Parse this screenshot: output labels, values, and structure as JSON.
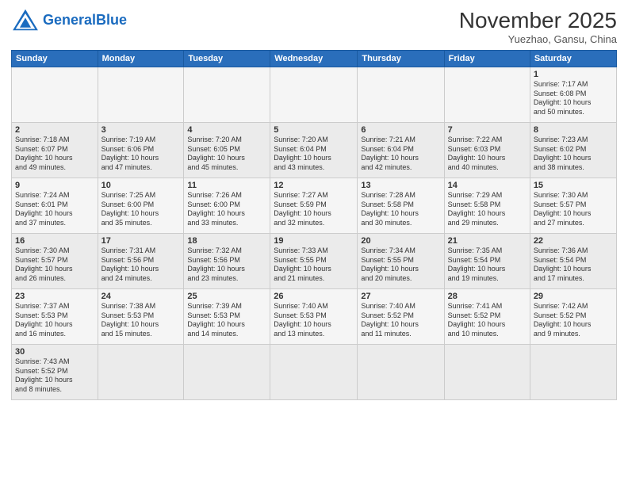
{
  "header": {
    "logo_general": "General",
    "logo_blue": "Blue",
    "month_title": "November 2025",
    "location": "Yuezhao, Gansu, China"
  },
  "weekdays": [
    "Sunday",
    "Monday",
    "Tuesday",
    "Wednesday",
    "Thursday",
    "Friday",
    "Saturday"
  ],
  "weeks": [
    [
      {
        "day": "",
        "info": ""
      },
      {
        "day": "",
        "info": ""
      },
      {
        "day": "",
        "info": ""
      },
      {
        "day": "",
        "info": ""
      },
      {
        "day": "",
        "info": ""
      },
      {
        "day": "",
        "info": ""
      },
      {
        "day": "1",
        "info": "Sunrise: 7:17 AM\nSunset: 6:08 PM\nDaylight: 10 hours\nand 50 minutes."
      }
    ],
    [
      {
        "day": "2",
        "info": "Sunrise: 7:18 AM\nSunset: 6:07 PM\nDaylight: 10 hours\nand 49 minutes."
      },
      {
        "day": "3",
        "info": "Sunrise: 7:19 AM\nSunset: 6:06 PM\nDaylight: 10 hours\nand 47 minutes."
      },
      {
        "day": "4",
        "info": "Sunrise: 7:20 AM\nSunset: 6:05 PM\nDaylight: 10 hours\nand 45 minutes."
      },
      {
        "day": "5",
        "info": "Sunrise: 7:20 AM\nSunset: 6:04 PM\nDaylight: 10 hours\nand 43 minutes."
      },
      {
        "day": "6",
        "info": "Sunrise: 7:21 AM\nSunset: 6:04 PM\nDaylight: 10 hours\nand 42 minutes."
      },
      {
        "day": "7",
        "info": "Sunrise: 7:22 AM\nSunset: 6:03 PM\nDaylight: 10 hours\nand 40 minutes."
      },
      {
        "day": "8",
        "info": "Sunrise: 7:23 AM\nSunset: 6:02 PM\nDaylight: 10 hours\nand 38 minutes."
      }
    ],
    [
      {
        "day": "9",
        "info": "Sunrise: 7:24 AM\nSunset: 6:01 PM\nDaylight: 10 hours\nand 37 minutes."
      },
      {
        "day": "10",
        "info": "Sunrise: 7:25 AM\nSunset: 6:00 PM\nDaylight: 10 hours\nand 35 minutes."
      },
      {
        "day": "11",
        "info": "Sunrise: 7:26 AM\nSunset: 6:00 PM\nDaylight: 10 hours\nand 33 minutes."
      },
      {
        "day": "12",
        "info": "Sunrise: 7:27 AM\nSunset: 5:59 PM\nDaylight: 10 hours\nand 32 minutes."
      },
      {
        "day": "13",
        "info": "Sunrise: 7:28 AM\nSunset: 5:58 PM\nDaylight: 10 hours\nand 30 minutes."
      },
      {
        "day": "14",
        "info": "Sunrise: 7:29 AM\nSunset: 5:58 PM\nDaylight: 10 hours\nand 29 minutes."
      },
      {
        "day": "15",
        "info": "Sunrise: 7:30 AM\nSunset: 5:57 PM\nDaylight: 10 hours\nand 27 minutes."
      }
    ],
    [
      {
        "day": "16",
        "info": "Sunrise: 7:30 AM\nSunset: 5:57 PM\nDaylight: 10 hours\nand 26 minutes."
      },
      {
        "day": "17",
        "info": "Sunrise: 7:31 AM\nSunset: 5:56 PM\nDaylight: 10 hours\nand 24 minutes."
      },
      {
        "day": "18",
        "info": "Sunrise: 7:32 AM\nSunset: 5:56 PM\nDaylight: 10 hours\nand 23 minutes."
      },
      {
        "day": "19",
        "info": "Sunrise: 7:33 AM\nSunset: 5:55 PM\nDaylight: 10 hours\nand 21 minutes."
      },
      {
        "day": "20",
        "info": "Sunrise: 7:34 AM\nSunset: 5:55 PM\nDaylight: 10 hours\nand 20 minutes."
      },
      {
        "day": "21",
        "info": "Sunrise: 7:35 AM\nSunset: 5:54 PM\nDaylight: 10 hours\nand 19 minutes."
      },
      {
        "day": "22",
        "info": "Sunrise: 7:36 AM\nSunset: 5:54 PM\nDaylight: 10 hours\nand 17 minutes."
      }
    ],
    [
      {
        "day": "23",
        "info": "Sunrise: 7:37 AM\nSunset: 5:53 PM\nDaylight: 10 hours\nand 16 minutes."
      },
      {
        "day": "24",
        "info": "Sunrise: 7:38 AM\nSunset: 5:53 PM\nDaylight: 10 hours\nand 15 minutes."
      },
      {
        "day": "25",
        "info": "Sunrise: 7:39 AM\nSunset: 5:53 PM\nDaylight: 10 hours\nand 14 minutes."
      },
      {
        "day": "26",
        "info": "Sunrise: 7:40 AM\nSunset: 5:53 PM\nDaylight: 10 hours\nand 13 minutes."
      },
      {
        "day": "27",
        "info": "Sunrise: 7:40 AM\nSunset: 5:52 PM\nDaylight: 10 hours\nand 11 minutes."
      },
      {
        "day": "28",
        "info": "Sunrise: 7:41 AM\nSunset: 5:52 PM\nDaylight: 10 hours\nand 10 minutes."
      },
      {
        "day": "29",
        "info": "Sunrise: 7:42 AM\nSunset: 5:52 PM\nDaylight: 10 hours\nand 9 minutes."
      }
    ],
    [
      {
        "day": "30",
        "info": "Sunrise: 7:43 AM\nSunset: 5:52 PM\nDaylight: 10 hours\nand 8 minutes."
      },
      {
        "day": "",
        "info": ""
      },
      {
        "day": "",
        "info": ""
      },
      {
        "day": "",
        "info": ""
      },
      {
        "day": "",
        "info": ""
      },
      {
        "day": "",
        "info": ""
      },
      {
        "day": "",
        "info": ""
      }
    ]
  ]
}
